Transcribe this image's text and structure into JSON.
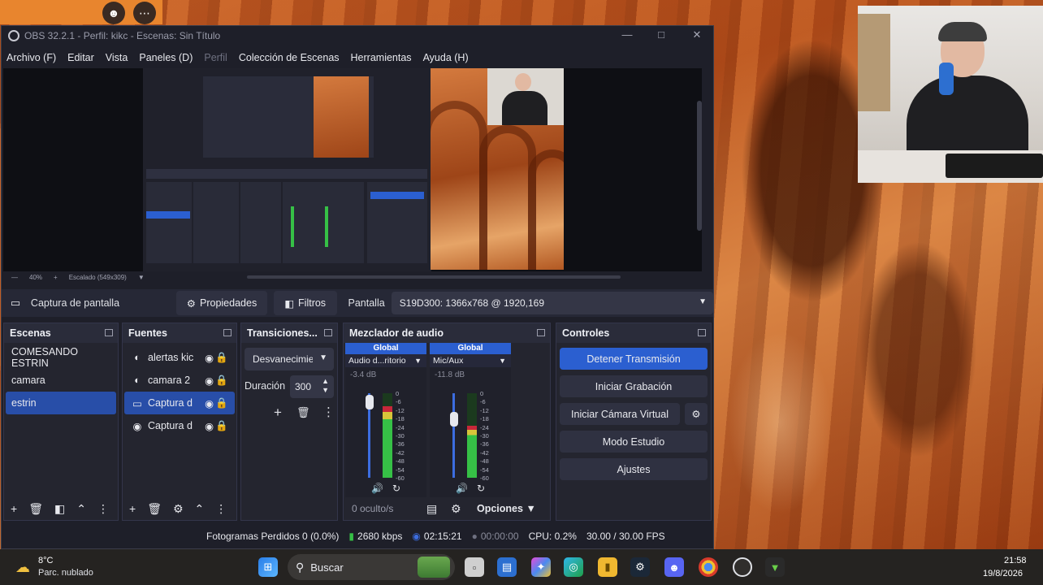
{
  "desktop": {
    "top_buttons": [
      "person-icon",
      "more-icon"
    ]
  },
  "window": {
    "title": "OBS 32.2.1 - Perfil: kikc - Escenas: Sin Título",
    "controls": [
      "minimize-icon",
      "maximize-icon",
      "close-icon"
    ]
  },
  "menu": [
    "Archivo (F)",
    "Editar",
    "Vista",
    "Paneles (D)",
    "Perfil",
    "Colección de Escenas",
    "Herramientas",
    "Ayuda (H)"
  ],
  "preview": {
    "zoom": "40%",
    "scale_label": "Escalado (549x309)"
  },
  "source_toolbar": {
    "source_name": "Captura de pantalla",
    "properties": "Propiedades",
    "filters": "Filtros",
    "screen_label": "Pantalla",
    "screen_value": "S19D300: 1366x768 @ 1920,169"
  },
  "scenes": {
    "title": "Escenas",
    "items": [
      "COMESANDO ESTRIN",
      "camara",
      "estrin"
    ],
    "selected": 2
  },
  "sources": {
    "title": "Fuentes",
    "items": [
      "alertas kic",
      "camara 2",
      "Captura d",
      "Captura d"
    ],
    "selected": 2
  },
  "transitions": {
    "title": "Transiciones...",
    "type": "Desvanecimie",
    "duration_label": "Duración",
    "duration_value": "300"
  },
  "mixer": {
    "title": "Mezclador de audio",
    "channels": [
      {
        "group": "Global",
        "name": "Audio d...ritorio",
        "db": "-3.4 dB",
        "level": 0.85
      },
      {
        "group": "Global",
        "name": "Mic/Aux",
        "db": "-11.8 dB",
        "level": 0.62
      }
    ],
    "scale": [
      "0",
      "-6",
      "-12",
      "-18",
      "-24",
      "-30",
      "-36",
      "-42",
      "-48",
      "-54",
      "-60"
    ],
    "hidden": "0 oculto/s",
    "options": "Opciones"
  },
  "controls": {
    "title": "Controles",
    "stop_stream": "Detener Transmisión",
    "start_recording": "Iniciar Grabación",
    "virtual_cam": "Iniciar Cámara Virtual",
    "studio_mode": "Modo Estudio",
    "settings": "Ajustes"
  },
  "status": {
    "dropped": "Fotogramas Perdidos 0 (0.0%)",
    "bitrate": "2680 kbps",
    "stream_time": "02:15:21",
    "rec_time": "00:00:00",
    "cpu": "CPU: 0.2%",
    "fps": "30.00 / 30.00 FPS"
  },
  "taskbar": {
    "weather_temp": "8°C",
    "weather_desc": "Parc. nublado",
    "search": "Buscar",
    "time": "21:58",
    "date": "19/8/2026",
    "colors": {
      "accent": "#2b5fd0",
      "selected": "#284ea8"
    }
  }
}
